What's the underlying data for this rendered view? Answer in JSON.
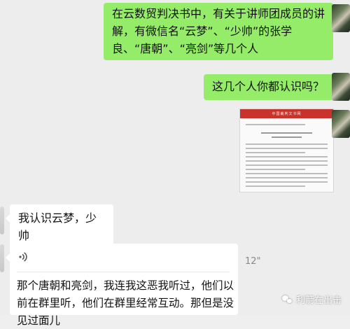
{
  "messages": [
    {
      "side": "right",
      "text": "在云数贸判决书中，有关于讲师团成员的讲解，有微信名“云梦”、“少帅”的张学良、“唐朝”、“亮剑”等几个人"
    },
    {
      "side": "right",
      "text": "这几个人你都认识吗？"
    },
    {
      "side": "right",
      "type": "image",
      "doc_title": "中国裁判文书网"
    },
    {
      "side": "left",
      "text": "我认识云梦，少帅"
    },
    {
      "side": "left",
      "type": "voice",
      "duration": "12\"",
      "transcript": "那个唐朝和亮剑，我连我这恶我听过，他们以前在群里听，他们在群里经常互动。那但是没见过面儿"
    }
  ],
  "watermark": {
    "text": "利箭在出击"
  },
  "icons": {
    "voice": "voice-wave-icon",
    "watermark": "wechat-logo-icon"
  },
  "colors": {
    "background": "#ededed",
    "my_bubble": "#95ec69",
    "other_bubble": "#ffffff",
    "doc_header": "#c8342b"
  }
}
